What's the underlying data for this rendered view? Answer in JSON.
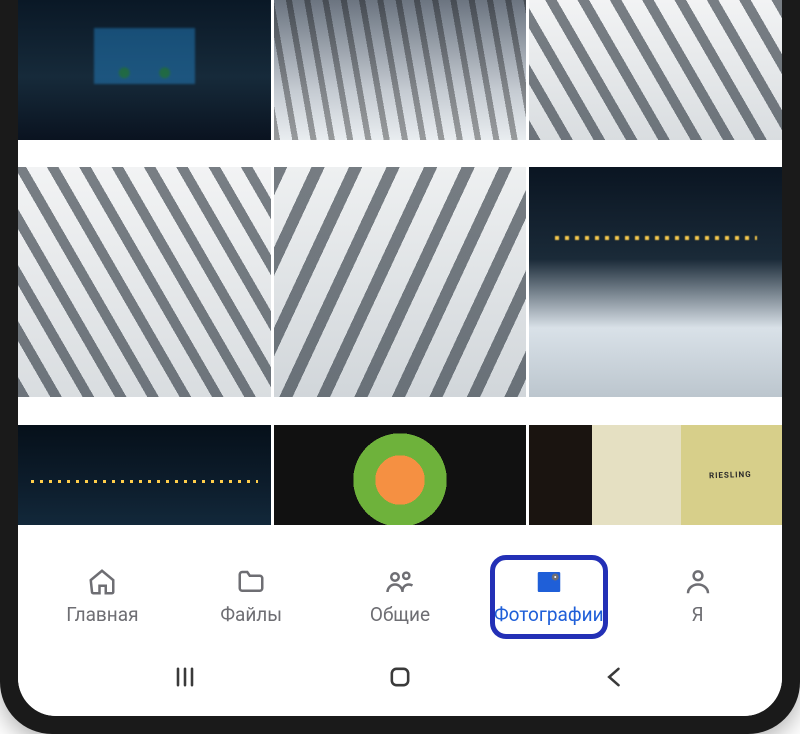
{
  "app_nav": {
    "items": [
      {
        "label": "Главная",
        "icon": "home-icon",
        "active": false
      },
      {
        "label": "Файлы",
        "icon": "folder-icon",
        "active": false
      },
      {
        "label": "Общие",
        "icon": "people-icon",
        "active": false
      },
      {
        "label": "Фотографии",
        "icon": "photos-icon",
        "active": true,
        "highlighted": true
      },
      {
        "label": "Я",
        "icon": "profile-icon",
        "active": false
      }
    ]
  },
  "system_nav": {
    "items": [
      "recent-apps",
      "home",
      "back"
    ]
  },
  "photo_grid": {
    "columns": 3,
    "thumbnails": [
      "night-fountain-lights",
      "snow-fence-railing",
      "fence-shadow-stripes",
      "railing-shadow-stripes-a",
      "railing-shadow-stripes-b",
      "city-night-snow",
      "city-night-distant",
      "poke-bowl-food",
      "wine-bottles"
    ]
  },
  "wine_label_text": "RIESLING"
}
